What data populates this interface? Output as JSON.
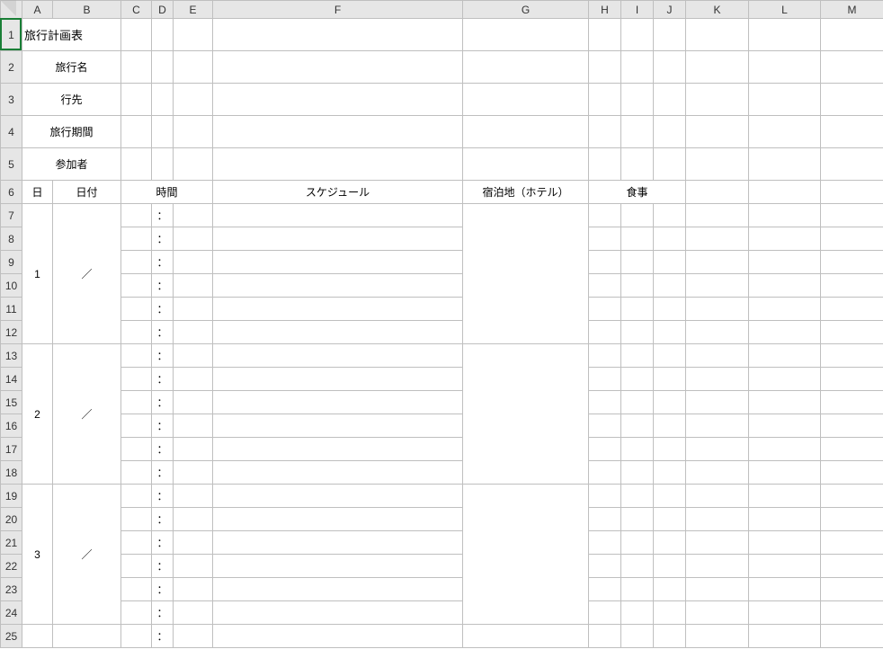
{
  "columns": [
    "",
    "A",
    "B",
    "C",
    "D",
    "E",
    "F",
    "G",
    "H",
    "I",
    "J",
    "K",
    "L",
    "M"
  ],
  "rows": [
    "1",
    "2",
    "3",
    "4",
    "5",
    "6",
    "7",
    "8",
    "9",
    "10",
    "11",
    "12",
    "13",
    "14",
    "15",
    "16",
    "17",
    "18",
    "19",
    "20",
    "21",
    "22",
    "23",
    "24",
    "25"
  ],
  "title": "旅行計画表",
  "labels": {
    "tripName": "旅行名",
    "destination": "行先",
    "period": "旅行期間",
    "participants": "参加者"
  },
  "headers": {
    "day": "日",
    "date": "日付",
    "time": "時間",
    "schedule": "スケジュール",
    "lodging": "宿泊地（ホテル）",
    "meal": "食事"
  },
  "blocks": [
    {
      "dayNum": "1",
      "dateMark": "／",
      "times": [
        "：",
        "：",
        "：",
        "：",
        "：",
        "："
      ]
    },
    {
      "dayNum": "2",
      "dateMark": "／",
      "times": [
        "：",
        "：",
        "：",
        "：",
        "：",
        "："
      ]
    },
    {
      "dayNum": "3",
      "dateMark": "／",
      "times": [
        "：",
        "：",
        "：",
        "：",
        "：",
        "："
      ]
    }
  ],
  "extraTime": "："
}
